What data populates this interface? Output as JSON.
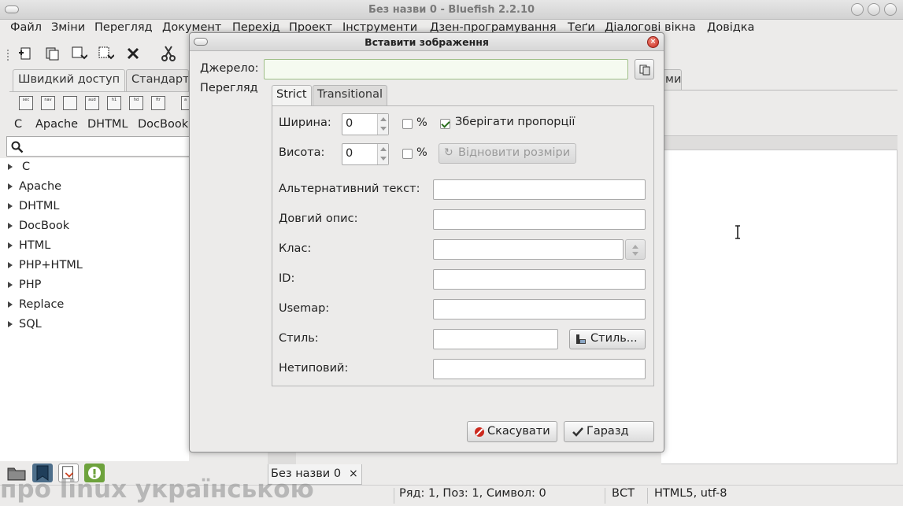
{
  "window": {
    "title": "Без назви 0 - Bluefish 2.2.10"
  },
  "menu": [
    "Файл",
    "Зміни",
    "Перегляд",
    "Документ",
    "Перехід",
    "Проект",
    "Інструменти",
    "Дзен-програмування",
    "Теґи",
    "Діалогові вікна",
    "Довідка"
  ],
  "quickbar": {
    "tabs": [
      "Швидкий доступ",
      "Стандарт"
    ],
    "right_tab_fragment": "ми"
  },
  "tagbar_icons": [
    "sec",
    "nav",
    "",
    "aud",
    "h1",
    "hd",
    "ftr",
    "a"
  ],
  "snippets": [
    "C",
    "Apache",
    "DHTML",
    "DocBook"
  ],
  "tree": {
    "items": [
      "C",
      "Apache",
      "DHTML",
      "DocBook",
      "HTML",
      "PHP+HTML",
      "PHP",
      "Replace",
      "SQL"
    ]
  },
  "doc_tab": {
    "label": "Без назви 0",
    "close": "×"
  },
  "status": {
    "position": "Ряд: 1, Поз: 1, Символ: 0",
    "mode": "ВСТ",
    "encoding": "HTML5, utf-8"
  },
  "watermark": "про linux українською",
  "dialog": {
    "title": "Вставити зображення",
    "source_label": "Джерело:",
    "source_value": "",
    "side_tab": "Перегляд",
    "tabs": [
      "Strict",
      "Transitional"
    ],
    "width_label": "Ширина:",
    "width_value": "0",
    "height_label": "Висота:",
    "height_value": "0",
    "percent_label": "%",
    "keep_ratio_label": "Зберігати пропорції",
    "keep_ratio_checked": true,
    "width_percent_checked": false,
    "height_percent_checked": false,
    "reset_size_label": "Відновити розміри",
    "alt_label": "Альтернативний текст:",
    "longdesc_label": "Довгий опис:",
    "class_label": "Клас:",
    "id_label": "ID:",
    "usemap_label": "Usemap:",
    "style_label": "Стиль:",
    "style_button": "Стиль...",
    "custom_label": "Нетиповий:",
    "cancel_button": "Скасувати",
    "ok_button": "Гаразд"
  },
  "colors": {
    "close_red": "#c9271c",
    "source_bg": "#f5faf0",
    "cancel_icon": "#cc2a1f",
    "ok_icon": "#333333"
  }
}
